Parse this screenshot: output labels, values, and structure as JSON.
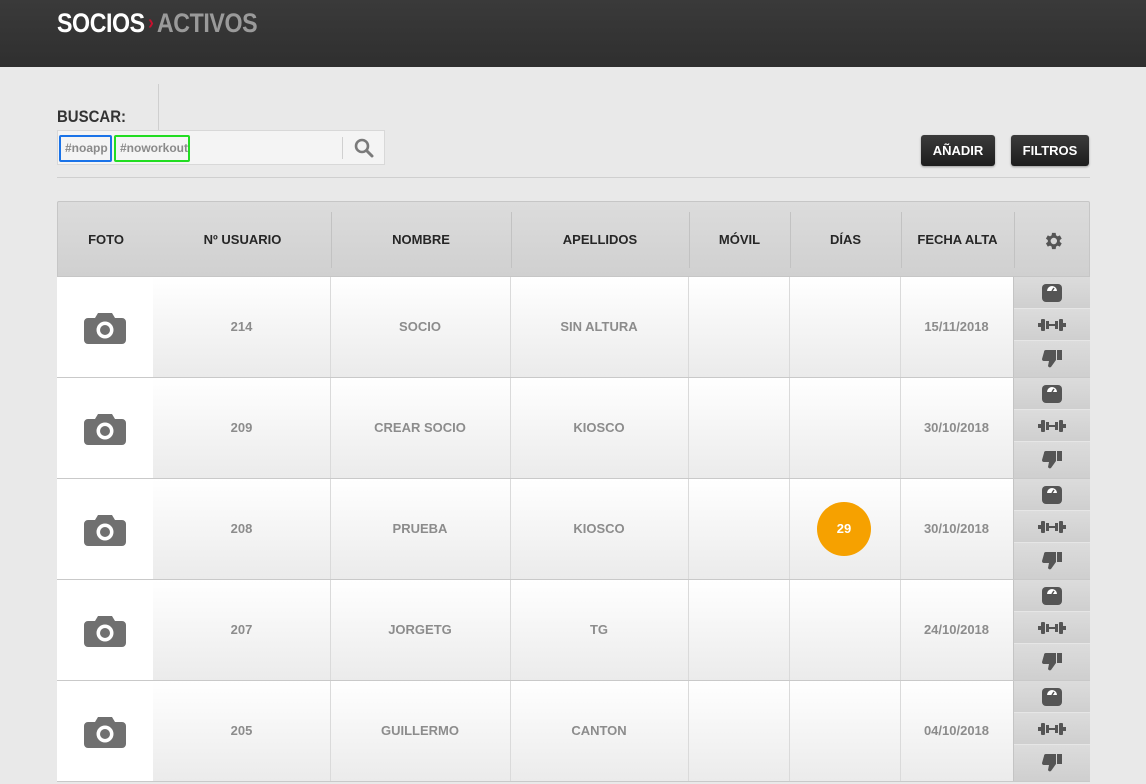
{
  "header": {
    "section": "SOCIOS",
    "separator": "›",
    "subsection": "ACTIVOS"
  },
  "search": {
    "label": "BUSCAR:",
    "tags": [
      "#noapp",
      "#noworkout"
    ],
    "value": "",
    "button_icon": "search-icon"
  },
  "toolbar": {
    "add_label": "AÑADIR",
    "filters_label": "FILTROS"
  },
  "table": {
    "columns": {
      "foto": "FOTO",
      "usuario": "Nº USUARIO",
      "nombre": "NOMBRE",
      "apellidos": "APELLIDOS",
      "movil": "MÓVIL",
      "dias": "DÍAS",
      "fecha": "FECHA ALTA",
      "settings_icon": "gear-icon"
    },
    "rows": [
      {
        "usuario": "214",
        "nombre": "SOCIO",
        "apellidos": "SIN ALTURA",
        "movil": "",
        "dias": "",
        "fecha": "15/11/2018"
      },
      {
        "usuario": "209",
        "nombre": "CREAR SOCIO",
        "apellidos": "KIOSCO",
        "movil": "",
        "dias": "",
        "fecha": "30/10/2018"
      },
      {
        "usuario": "208",
        "nombre": "PRUEBA",
        "apellidos": "KIOSCO",
        "movil": "",
        "dias": "29",
        "fecha": "30/10/2018"
      },
      {
        "usuario": "207",
        "nombre": "JORGETG",
        "apellidos": "TG",
        "movil": "",
        "dias": "",
        "fecha": "24/10/2018"
      },
      {
        "usuario": "205",
        "nombre": "GUILLERMO",
        "apellidos": "CANTON",
        "movil": "",
        "dias": "",
        "fecha": "04/10/2018"
      }
    ],
    "row_action_icons": [
      "scale-icon",
      "dumbbell-icon",
      "thumbs-down-icon"
    ],
    "photo_icon": "camera-icon"
  },
  "colors": {
    "topbar": "#333333",
    "accent": "#c8102e",
    "days_badge": "#f6a100",
    "tag_noapp_border": "#1a73e8",
    "tag_noworkout_border": "#22dd22"
  }
}
